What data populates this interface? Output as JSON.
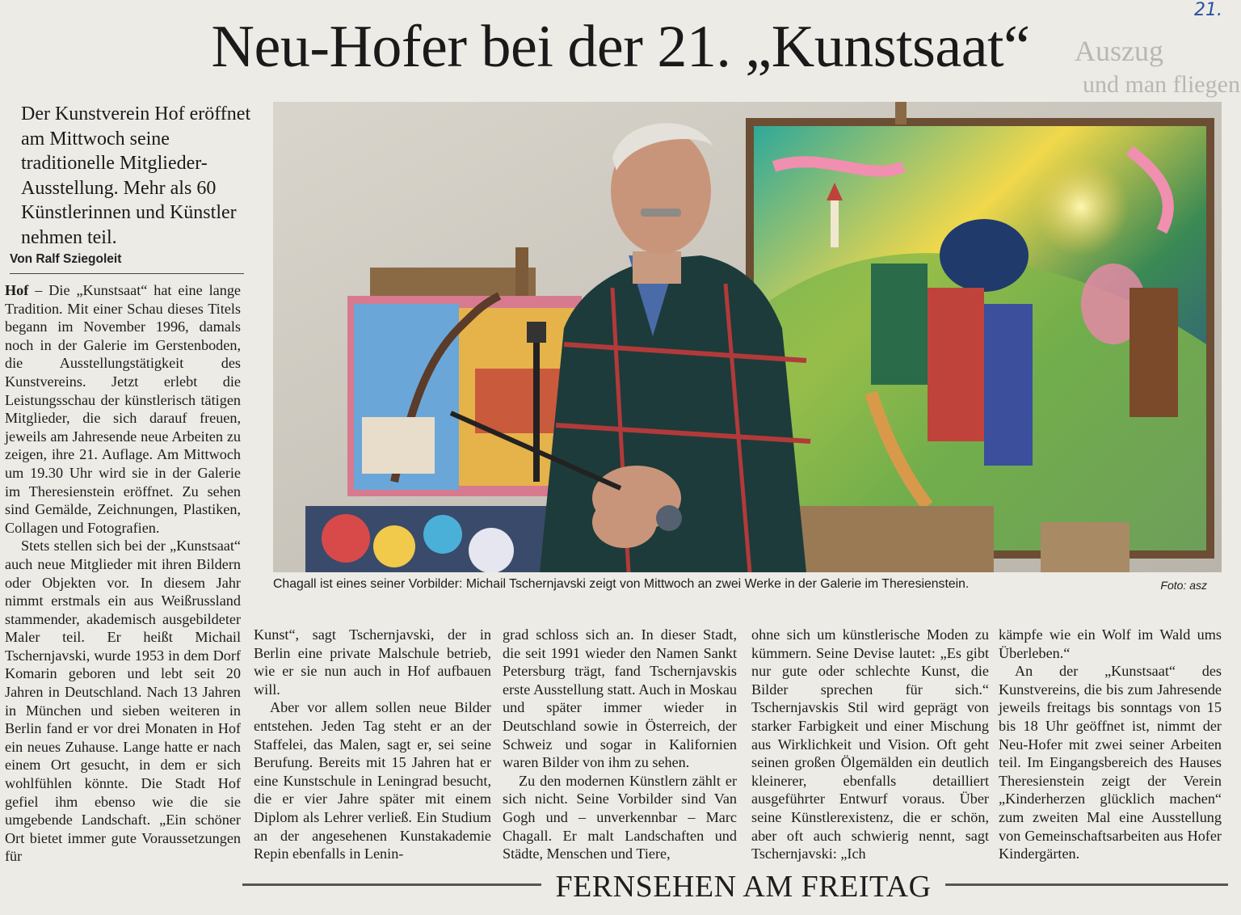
{
  "page_number": "21.",
  "headline": "Neu-Hofer bei der 21. „Kunstsaat“",
  "lead": "Der Kunstverein Hof eröffnet am Mittwoch seine traditionelle Mitglieder-Ausstellung. Mehr als 60 Künstlerinnen und Künstler nehmen teil.",
  "byline": "Von Ralf Sziegoleit",
  "ghost_text": {
    "top_right_1": "Auszug",
    "top_right_2": "und man fliegen"
  },
  "photo": {
    "caption": "Chagall ist eines seiner Vorbilder: Michail Tschernjavski zeigt von Mittwoch an zwei Werke in der Galerie im Theresienstein.",
    "credit": "Foto: asz"
  },
  "columns": {
    "col1": {
      "dateline": "Hof",
      "p1": " – Die „Kunstsaat“ hat eine lange Tradition. Mit einer Schau dieses Titels begann im November 1996, damals noch in der Galerie im Gerstenboden, die Ausstellungstätigkeit des Kunstvereins. Jetzt erlebt die Leistungsschau der künstlerisch tätigen Mitglieder, die sich darauf freuen, jeweils am Jahresende neue Arbeiten zu zeigen, ihre 21. Auflage. Am Mittwoch um 19.30 Uhr wird sie in der Galerie im Theresienstein eröffnet. Zu sehen sind Gemälde, Zeichnungen, Plastiken, Collagen und Fotografien.",
      "p2": "Stets stellen sich bei der „Kunstsaat“ auch neue Mitglieder mit ihren Bildern oder Objekten vor. In diesem Jahr nimmt erstmals ein aus Weißrussland stammender, akademisch ausgebildeter Maler teil. Er heißt Michail Tschernjavski, wurde 1953 in dem Dorf Komarin geboren und lebt seit 20 Jahren in Deutschland. Nach 13 Jahren in München und sieben weiteren in Berlin fand er vor drei Monaten in Hof ein neues Zuhause. Lange hatte er nach einem Ort gesucht, in dem er sich wohlfühlen könnte. Die Stadt Hof gefiel ihm ebenso wie die sie umgebende Landschaft. „Ein schöner Ort bietet immer gute Voraussetzungen für"
    },
    "col2": {
      "p1": "Kunst“, sagt Tschernjavski, der in Berlin eine private Malschule betrieb, wie er sie nun auch in Hof aufbauen will.",
      "p2": "Aber vor allem sollen neue Bilder entstehen. Jeden Tag steht er an der Staffelei, das Malen, sagt er, sei seine Berufung. Bereits mit 15 Jahren hat er eine Kunstschule in Leningrad besucht, die er vier Jahre später mit einem Diplom als Lehrer verließ. Ein Studium an der angesehenen Kunstakademie Repin ebenfalls in Lenin-"
    },
    "col3": {
      "p1": "grad schloss sich an. In dieser Stadt, die seit 1991 wieder den Namen Sankt Petersburg trägt, fand Tschernjavskis erste Ausstellung statt. Auch in Moskau und später immer wieder in Deutschland sowie in Österreich, der Schweiz und sogar in Kalifornien waren Bilder von ihm zu sehen.",
      "p2": "Zu den modernen Künstlern zählt er sich nicht. Seine Vorbilder sind Van Gogh und – unverkennbar – Marc Chagall. Er malt Landschaften und Städte, Menschen und Tiere,"
    },
    "col4": {
      "p1": "ohne sich um künstlerische Moden zu kümmern. Seine Devise lautet: „Es gibt nur gute oder schlechte Kunst, die Bilder sprechen für sich.“ Tschernjavskis Stil wird geprägt von starker Farbigkeit und einer Mischung aus Wirklichkeit und Vision. Oft geht seinen großen Ölgemälden ein deutlich kleinerer, ebenfalls detailliert ausgeführter Entwurf voraus. Über seine Künstlerexistenz, die er schön, aber oft auch schwierig nennt, sagt Tschernjavski: „Ich"
    },
    "col5": {
      "p1": "kämpfe wie ein Wolf im Wald ums Überleben.“",
      "p2": "An der „Kunstsaat“ des Kunstvereins, die bis zum Jahresende jeweils freitags bis sonntags von 15 bis 18 Uhr geöffnet ist, nimmt der Neu-Hofer mit zwei seiner Arbeiten teil. Im Eingangsbereich des Hauses Theresienstein zeigt der Verein „Kinderherzen glücklich machen“ zum zweiten Mal eine Ausstellung von Gemeinschaftsarbeiten aus Hofer Kindergärten."
    }
  },
  "footer_section": "FERNSEHEN AM FREITAG"
}
